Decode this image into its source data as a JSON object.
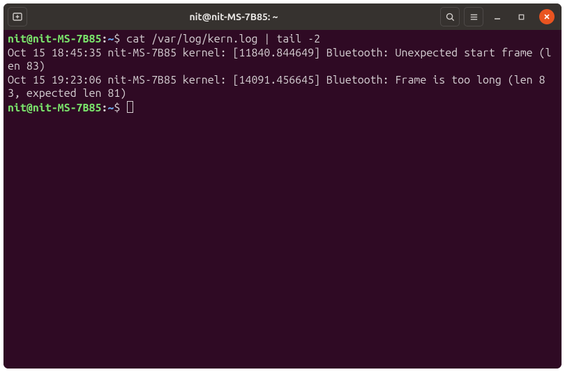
{
  "window": {
    "title": "nit@nit-MS-7B85: ~"
  },
  "icons": {
    "new_tab": "new-tab-icon",
    "search": "search-icon",
    "menu": "hamburger-icon",
    "minimize": "minimize-icon",
    "maximize": "maximize-icon",
    "close": "close-icon"
  },
  "prompt": {
    "user_host": "nit@nit-MS-7B85",
    "sep": ":",
    "path": "~",
    "symbol": "$"
  },
  "session": {
    "command1": "cat /var/log/kern.log | tail -2",
    "out1": "Oct 15 18:45:35 nit-MS-7B85 kernel: [11840.844649] Bluetooth: Unexpected start frame (len 83)",
    "out2": "Oct 15 19:23:06 nit-MS-7B85 kernel: [14091.456645] Bluetooth: Frame is too long (len 83, expected len 81)"
  }
}
